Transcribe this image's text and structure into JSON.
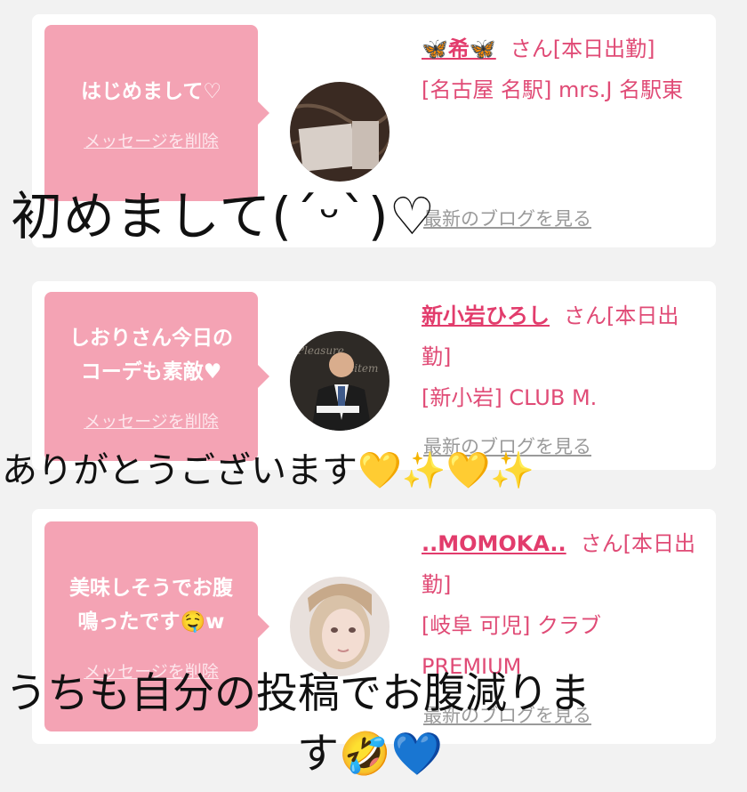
{
  "cards": [
    {
      "message": "はじめまして♡",
      "delete_label": "メッセージを削除",
      "name": "🦋希🦋",
      "suffix": "さん[本日出勤]",
      "location": "[名古屋 名駅] mrs.J 名駅東",
      "blog_label": "最新のブログを見る",
      "avatar_icon": "avatar-marble"
    },
    {
      "message": "しおりさん今日の\nコーデも素敵♥",
      "delete_label": "メッセージを削除",
      "name": "新小岩ひろし",
      "suffix": "さん[本日出勤]",
      "location": "[新小岩] CLUB M.",
      "blog_label": "最新のブログを見る",
      "avatar_icon": "avatar-man-suit"
    },
    {
      "message": "美味しそうでお腹\n鳴ったです🤤w",
      "delete_label": "メッセージを削除",
      "name": "..MOMOKA..",
      "suffix": "さん[本日出勤]",
      "location": "[岐阜 可児] クラブ PREMIUM",
      "blog_label": "最新のブログを見る",
      "avatar_icon": "avatar-woman"
    }
  ],
  "captions": {
    "first": "初めまして(ˊᵕˋ)♡",
    "second": "ありがとうございます💛✨💛✨",
    "third_line1": "うちも自分の投稿でお腹減りま",
    "third_line2": "す🤣💙"
  },
  "colors": {
    "background": "#f2f2f2",
    "bubble": "#f4a3b4",
    "accent_text": "#e04b76",
    "muted_link": "#9a9a9a"
  }
}
